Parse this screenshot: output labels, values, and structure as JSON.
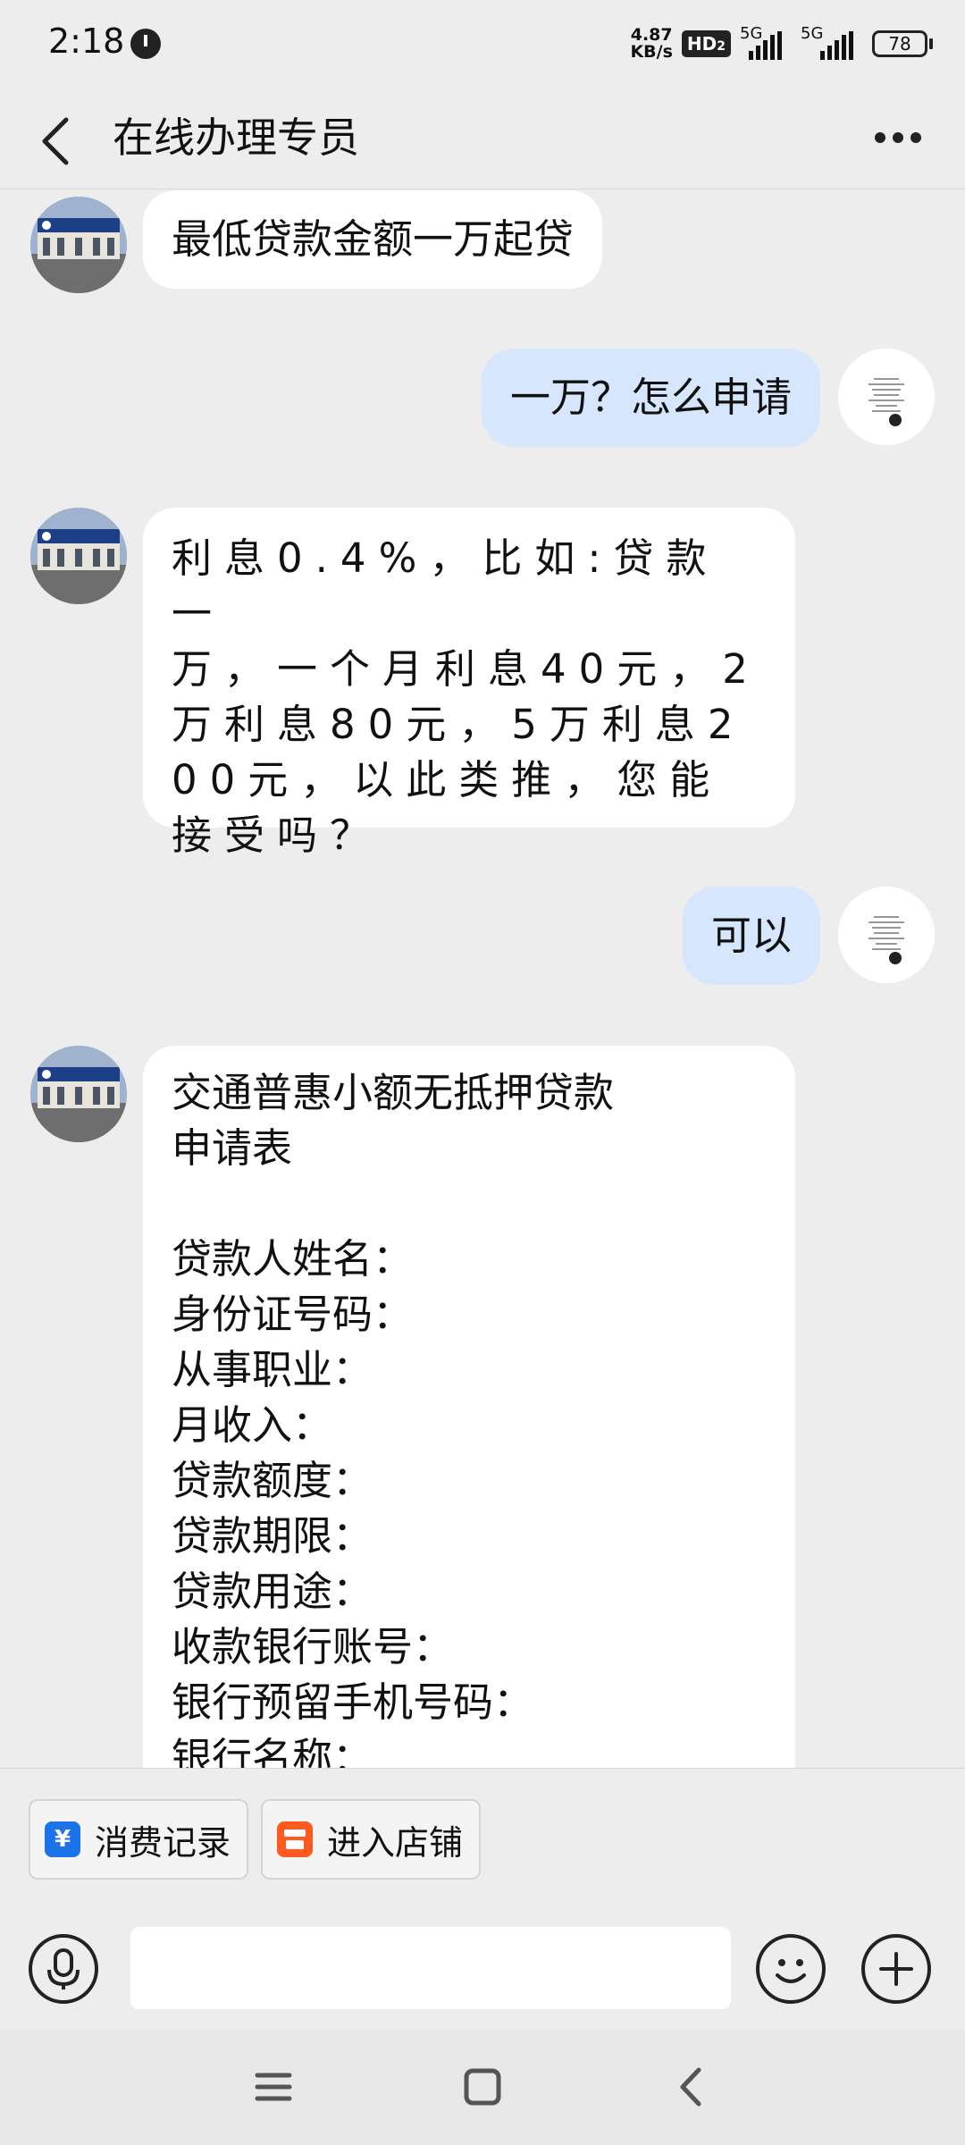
{
  "status_bar": {
    "time": "2:18",
    "net_speed_value": "4.87",
    "net_speed_unit": "KB/s",
    "hd_label": "HD",
    "hd_sub": "2",
    "sig1_label": "5G",
    "sig2_label": "5G",
    "battery": "78"
  },
  "header": {
    "title": "在线办理专员"
  },
  "messages": [
    {
      "from": "agent",
      "text": "最低贷款金额一万起贷"
    },
    {
      "from": "user",
      "text": "一万？怎么申请"
    },
    {
      "from": "agent",
      "text": "利息0.4%，比如:贷款一\n万，一个月利息40元，2\n万利息80元，5万利息2\n00元，以此类推，您能\n接受吗？"
    },
    {
      "from": "user",
      "text": "可以"
    },
    {
      "from": "agent",
      "text": "交通普惠小额无抵押贷款\n申请表\n\n贷款人姓名：\n身份证号码：\n从事职业：\n月收入：\n贷款额度：\n贷款期限：\n贷款用途：\n收款银行账号：\n银行预留手机号码：\n银行名称："
    }
  ],
  "quick_actions": [
    {
      "label": "消费记录",
      "icon": "yuan-icon",
      "color": "#1a73e8"
    },
    {
      "label": "进入店铺",
      "icon": "store-icon",
      "color": "#ff5a1f"
    }
  ],
  "input": {
    "placeholder": ""
  },
  "colors": {
    "background": "#ededed",
    "incoming_bubble": "#ffffff",
    "outgoing_bubble": "#d6e6fd"
  }
}
